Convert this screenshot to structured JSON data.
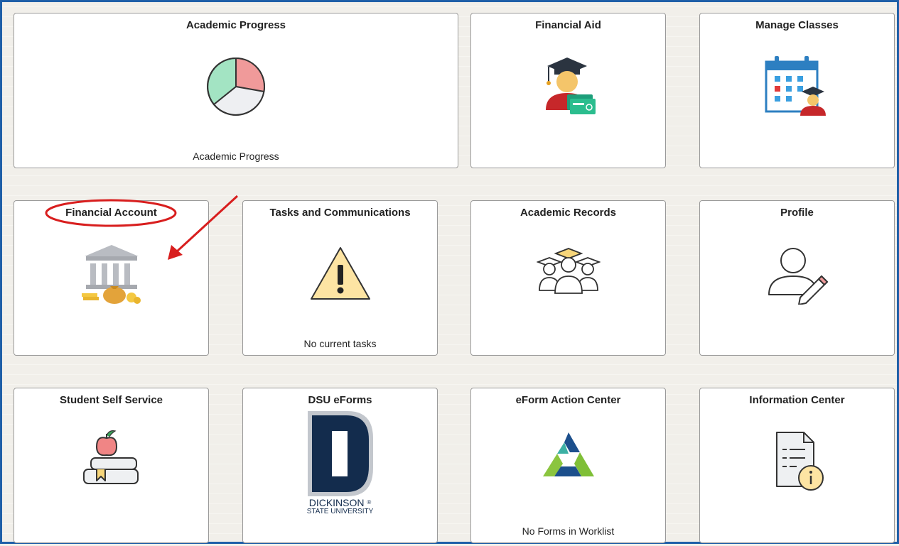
{
  "tiles": [
    {
      "title": "Academic Progress",
      "footer": "Academic Progress",
      "icon": "pie-chart-icon"
    },
    {
      "title": "Financial Aid",
      "icon": "graduate-with-money-icon"
    },
    {
      "title": "Manage Classes",
      "icon": "calendar-student-icon"
    },
    {
      "title": "Financial Account",
      "icon": "bank-money-icon"
    },
    {
      "title": "Tasks and Communications",
      "footer": "No current tasks",
      "icon": "warning-icon"
    },
    {
      "title": "Academic Records",
      "icon": "graduates-group-icon"
    },
    {
      "title": "Profile",
      "icon": "user-edit-icon"
    },
    {
      "title": "Student Self Service",
      "icon": "books-apple-icon"
    },
    {
      "title": "DSU eForms",
      "icon": "dsu-logo"
    },
    {
      "title": "eForm Action Center",
      "footer": "No Forms in Worklist",
      "icon": "triangle-logo-icon"
    },
    {
      "title": "Information Center",
      "icon": "document-info-icon"
    }
  ],
  "dsu_logo": {
    "letter": "D",
    "line1": "DICKINSON",
    "line2": "STATE UNIVERSITY",
    "reg": "®"
  },
  "colors": {
    "frame": "#1f5fa8",
    "annotation": "#d81e1e",
    "pie_green": "#a3e4c3",
    "pie_red": "#f09a9a",
    "warning": "#fde4a3"
  }
}
